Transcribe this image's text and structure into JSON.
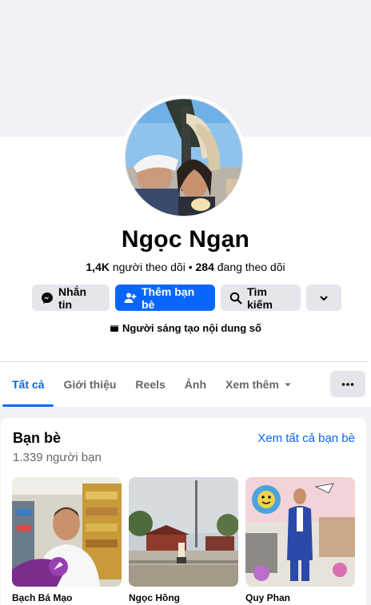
{
  "profile": {
    "name": "Ngọc Ngạn",
    "followers": "1,4K",
    "followers_label": "người theo dõi",
    "separator": "•",
    "following": "284",
    "following_label": "đang theo dõi",
    "category": "Người sáng tạo nội dung số"
  },
  "actions": {
    "message": "Nhắn tin",
    "add_friend": "Thêm bạn bè",
    "search": "Tìm kiếm"
  },
  "tabs": [
    {
      "label": "Tất cả",
      "active": true
    },
    {
      "label": "Giới thiệu"
    },
    {
      "label": "Reels"
    },
    {
      "label": "Ảnh"
    },
    {
      "label": "Xem thêm"
    }
  ],
  "friends": {
    "title": "Bạn bè",
    "count": "1.339 người bạn",
    "see_all": "Xem tất cả bạn bè",
    "items": [
      {
        "name": "Bạch Bá Mạo"
      },
      {
        "name": "Ngọc Hồng"
      },
      {
        "name": "Quy Phan"
      }
    ]
  },
  "colors": {
    "accent": "#0866ff",
    "background": "#f0f2f5",
    "secondary_text": "#65676b",
    "button_gray": "#e4e6eb"
  },
  "icons": [
    "messenger-icon",
    "add-friend-icon",
    "search-icon",
    "chevron-down-icon",
    "creator-icon",
    "caret-down-icon",
    "more-icon"
  ]
}
